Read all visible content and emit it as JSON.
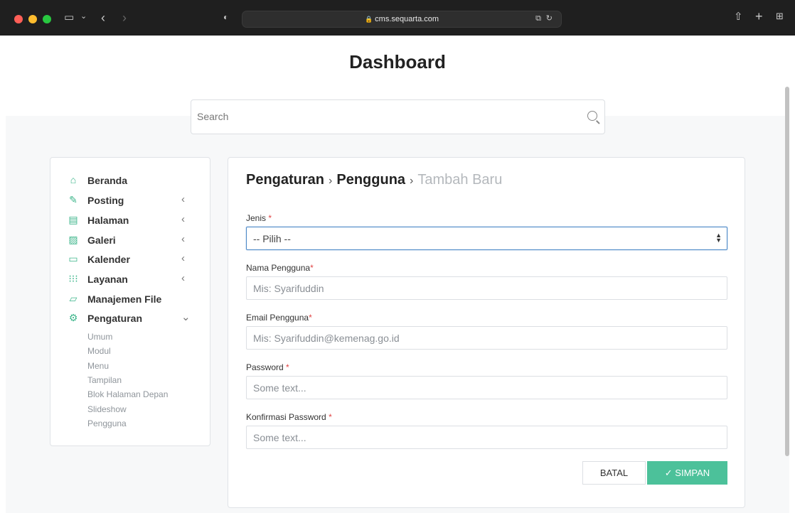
{
  "browser": {
    "url": "cms.sequarta.com",
    "icons": [
      "sidebar-toggle-icon",
      "back-icon",
      "forward-icon",
      "shield-icon",
      "translate-icon",
      "reload-icon",
      "share-icon",
      "new-tab-icon",
      "tab-overview-icon"
    ]
  },
  "page": {
    "title": "Dashboard"
  },
  "search": {
    "placeholder": "Search"
  },
  "sidebar": {
    "items": [
      {
        "label": "Beranda",
        "icon": "home-icon",
        "chevron": ""
      },
      {
        "label": "Posting",
        "icon": "edit-icon",
        "chevron": "‹"
      },
      {
        "label": "Halaman",
        "icon": "page-icon",
        "chevron": "‹"
      },
      {
        "label": "Galeri",
        "icon": "image-icon",
        "chevron": "‹"
      },
      {
        "label": "Kalender",
        "icon": "calendar-icon",
        "chevron": "‹"
      },
      {
        "label": "Layanan",
        "icon": "grid-icon",
        "chevron": "‹"
      },
      {
        "label": "Manajemen File",
        "icon": "folder-icon",
        "chevron": ""
      },
      {
        "label": "Pengaturan",
        "icon": "gear-icon",
        "chevron": "⌄"
      }
    ],
    "subitems": [
      "Umum",
      "Modul",
      "Menu",
      "Tampilan",
      "Blok Halaman Depan",
      "Slideshow",
      "Pengguna"
    ]
  },
  "breadcrumb": {
    "part1": "Pengaturan",
    "sep1": "›",
    "part2": "Pengguna",
    "sep2": "›",
    "part3": "Tambah Baru"
  },
  "form": {
    "jenis": {
      "label": "Jenis",
      "required": "*",
      "value": "-- Pilih --"
    },
    "nama": {
      "label": "Nama Pengguna",
      "required": "*",
      "placeholder": "Mis: Syarifuddin"
    },
    "email": {
      "label": "Email Pengguna",
      "required": "*",
      "placeholder": "Mis: Syarifuddin@kemenag.go.id"
    },
    "password": {
      "label": "Password",
      "required": "*",
      "placeholder": "Some text..."
    },
    "konfirmasi": {
      "label": "Konfirmasi Password",
      "required": "*",
      "placeholder": "Some text..."
    },
    "batal_label": "BATAL",
    "simpan_label": "✓ SIMPAN"
  },
  "colors": {
    "accent": "#4cc19a",
    "icon_green": "#3cb58a",
    "required": "#e04444",
    "select_focus": "#4b88c7"
  }
}
